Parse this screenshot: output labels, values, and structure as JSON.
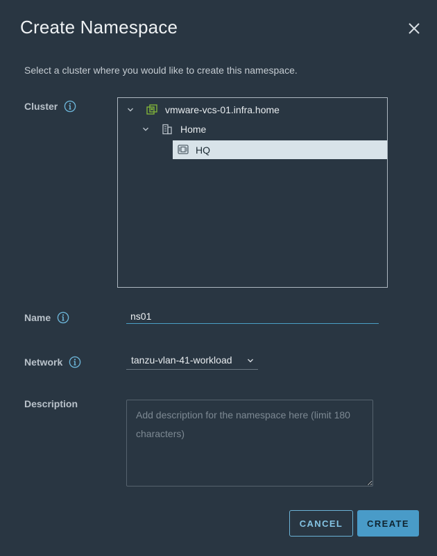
{
  "dialog": {
    "title": "Create Namespace",
    "subtitle": "Select a cluster where you would like to create this namespace."
  },
  "fields": {
    "cluster_label": "Cluster",
    "name_label": "Name",
    "network_label": "Network",
    "description_label": "Description"
  },
  "tree": {
    "nodes": [
      {
        "label": "vmware-vcs-01.infra.home",
        "icon": "vcenter-icon",
        "expanded": true,
        "selected": false
      },
      {
        "label": "Home",
        "icon": "datacenter-icon",
        "expanded": true,
        "selected": false
      },
      {
        "label": "HQ",
        "icon": "cluster-icon",
        "expanded": false,
        "selected": true
      }
    ]
  },
  "name": {
    "value": "ns01"
  },
  "network": {
    "selected": "tanzu-vlan-41-workload"
  },
  "description": {
    "value": "",
    "placeholder": "Add description for the namespace here (limit 180 characters)"
  },
  "buttons": {
    "cancel": "CANCEL",
    "create": "CREATE"
  },
  "colors": {
    "background": "#293642",
    "accent": "#499bc8",
    "selected_row": "#d8e3e9",
    "vcenter_icon": "#7fb23b"
  }
}
